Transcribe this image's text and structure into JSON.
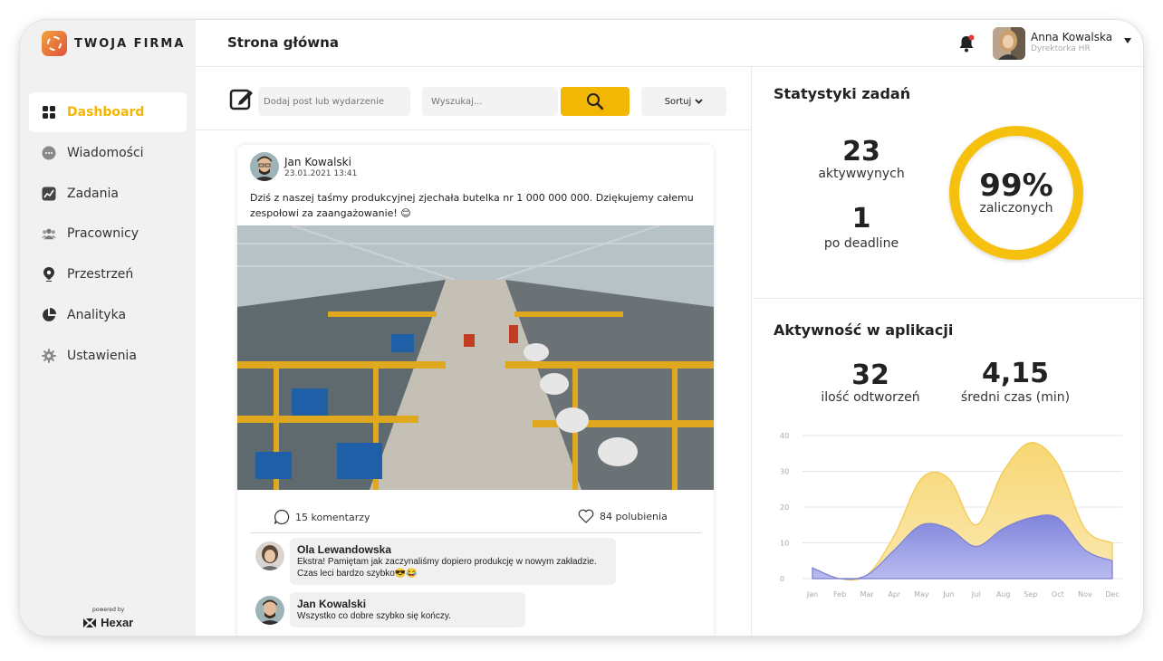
{
  "brand": {
    "name": "TWOJA FIRMA"
  },
  "sidebar": {
    "items": [
      {
        "label": "Dashboard",
        "icon": "grid-icon",
        "active": true
      },
      {
        "label": "Wiadomości",
        "icon": "chat-icon",
        "active": false
      },
      {
        "label": "Zadania",
        "icon": "trend-icon",
        "active": false
      },
      {
        "label": "Pracownicy",
        "icon": "people-icon",
        "active": false
      },
      {
        "label": "Przestrzeń",
        "icon": "location-pin-icon",
        "active": false
      },
      {
        "label": "Analityka",
        "icon": "pie-chart-icon",
        "active": false
      },
      {
        "label": "Ustawienia",
        "icon": "gear-icon",
        "active": false
      }
    ],
    "powered_by": "powered by",
    "powered_brand": "Hexar"
  },
  "header": {
    "title": "Strona główna",
    "user_name": "Anna Kowalska",
    "user_role": "Dyrektorka HR"
  },
  "toolbar": {
    "post_placeholder": "Dodaj post lub wydarzenie",
    "search_placeholder": "Wyszukaj...",
    "sort_label": "Sortuj"
  },
  "post": {
    "author": "Jan Kowalski",
    "date": "23.01.2021 13:41",
    "text": "Dziś z naszej taśmy produkcyjnej zjechała butelka nr 1 000 000 000. Dziękujemy całemu zespołowi za zaangażowanie! 😊",
    "comments_label": "15 komentarzy",
    "likes_label": "84 polubienia",
    "comments": [
      {
        "author": "Ola Lewandowska",
        "text_line1": "Ekstra! Pamiętam jak zaczynaliśmy dopiero produkcję w nowym zakładzie.",
        "text_line2": "Czas leci bardzo szybko😎😂"
      },
      {
        "author": "Jan Kowalski",
        "text_line1": "Wszystko co dobre szybko się kończy.",
        "text_line2": ""
      }
    ]
  },
  "task_stats": {
    "title": "Statystyki zadań",
    "active_value": "23",
    "active_label": "aktywwynych",
    "deadline_value": "1",
    "deadline_label": "po deadline",
    "ring_value": "99%",
    "ring_label": "zaliczonych",
    "ring_fraction": 0.99
  },
  "activity": {
    "title": "Aktywność w aplikacji",
    "plays_value": "32",
    "plays_label": "ilość odtworzeń",
    "avg_value": "4,15",
    "avg_label": "średni czas (min)"
  },
  "colors": {
    "accent": "#f2b705",
    "ring": "#f6c00f",
    "series_yellow": "#f7d774",
    "series_blue": "#8a8fe0"
  },
  "chart_data": {
    "type": "area",
    "categories": [
      "Jan",
      "Feb",
      "Mar",
      "Apr",
      "May",
      "Jun",
      "Jul",
      "Aug",
      "Sep",
      "Oct",
      "Nov",
      "Dec"
    ],
    "series": [
      {
        "values": [
          3,
          0,
          1,
          12,
          28,
          28,
          15,
          30,
          38,
          32,
          14,
          10
        ]
      },
      {
        "values": [
          3,
          0,
          1,
          8,
          15,
          14,
          9,
          14,
          17,
          17,
          8,
          5
        ]
      }
    ],
    "yticks": [
      0,
      10,
      20,
      30,
      40
    ],
    "ylim": [
      0,
      40
    ],
    "grid": true
  }
}
